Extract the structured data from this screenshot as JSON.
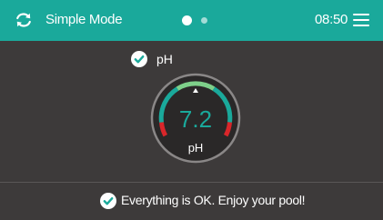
{
  "header": {
    "mode_label": "Simple Mode",
    "time": "08:50",
    "pages": {
      "count": 2,
      "active": 1
    }
  },
  "sensor": {
    "label": "pH",
    "value": "7.2",
    "unit": "pH",
    "status_icon": "check-circle-icon"
  },
  "status": {
    "message": "Everything is OK. Enjoy your pool!",
    "icon": "check-circle-icon"
  },
  "colors": {
    "header_bg": "#1aa99b",
    "background": "#3d3a3a",
    "gauge_ok": "#1aa99b",
    "gauge_alert": "#d9262a",
    "gauge_good_top": "#7ed08a"
  },
  "icons": {
    "mode": "refresh-icon",
    "menu": "hamburger-menu-icon"
  }
}
